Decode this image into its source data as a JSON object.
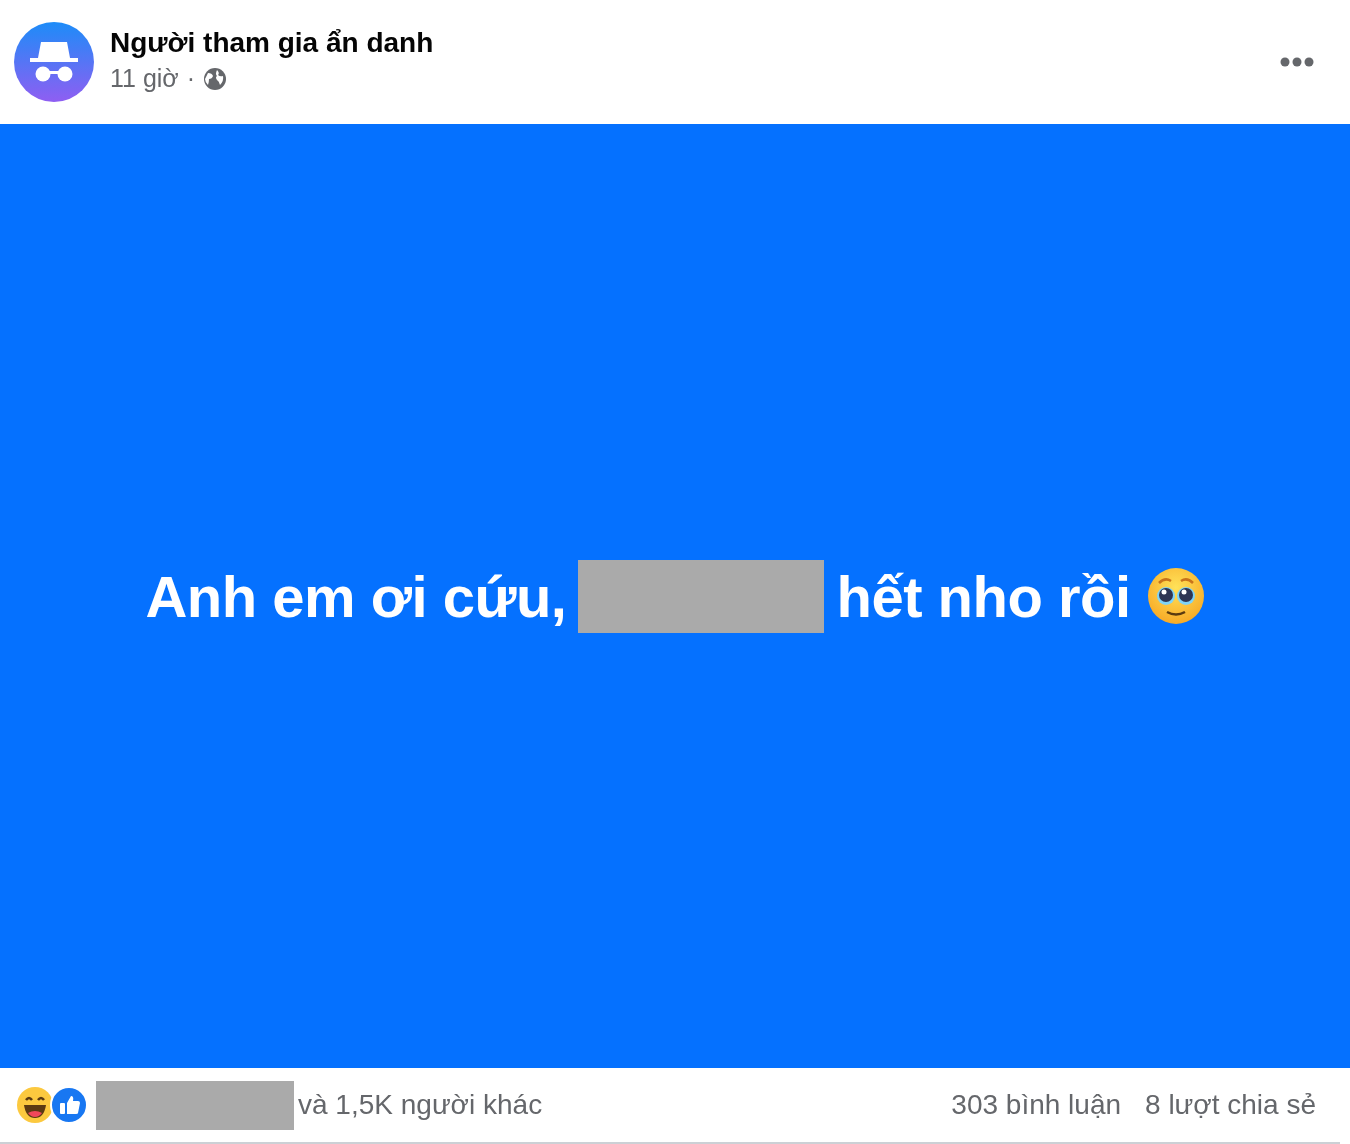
{
  "post": {
    "author": "Người tham gia ẩn danh",
    "time": "11 giờ",
    "separator": "·",
    "text_before": "Anh em ơi cứu,",
    "text_after": "hết nho rồi"
  },
  "footer": {
    "reactions_text": "và 1,5K người khác",
    "comments": "303 bình luận",
    "shares": "8 lượt chia sẻ"
  }
}
